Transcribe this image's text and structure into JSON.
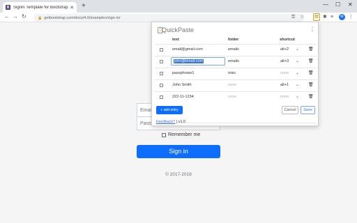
{
  "browser": {
    "tab_title": "Signin Template for Bootstrap",
    "tab_favicon": "B",
    "url": "getbootstrap.com/docs/4.0/examples/sign-in/",
    "avatar_letter": "M"
  },
  "page": {
    "email_placeholder": "Email",
    "password_placeholder": "Passw",
    "remember_label": "Remember me",
    "signin_label": "Sign in",
    "copyright": "© 2017-2018"
  },
  "popup": {
    "title": "QuickPaste",
    "headers": {
      "text": "text",
      "folder": "folder",
      "shortcut": "shortcut"
    },
    "rows": [
      {
        "text": "email@gmail.com",
        "folder": "emails",
        "shortcut": "alt+2",
        "folder_muted": false,
        "shortcut_muted": false
      },
      {
        "text": "john@email.com",
        "folder": "emails",
        "shortcut": "alt+3",
        "folder_muted": false,
        "shortcut_muted": false
      },
      {
        "text": "passphrase1",
        "folder": "misc",
        "shortcut": "none",
        "folder_muted": false,
        "shortcut_muted": true
      },
      {
        "text": "John Smith",
        "folder": "none",
        "shortcut": "alt+1",
        "folder_muted": true,
        "shortcut_muted": false
      },
      {
        "text": "222-11-1234",
        "folder": "none",
        "shortcut": "none",
        "folder_muted": true,
        "shortcut_muted": true
      }
    ],
    "add_entry_label": "+ add entry",
    "cancel_label": "Cancel",
    "save_label": "Save",
    "feedback_label": "Feedback?",
    "version": "| v1.0"
  },
  "colors": {
    "primary": "#0d6efd",
    "accent_blue": "#3874d8"
  }
}
